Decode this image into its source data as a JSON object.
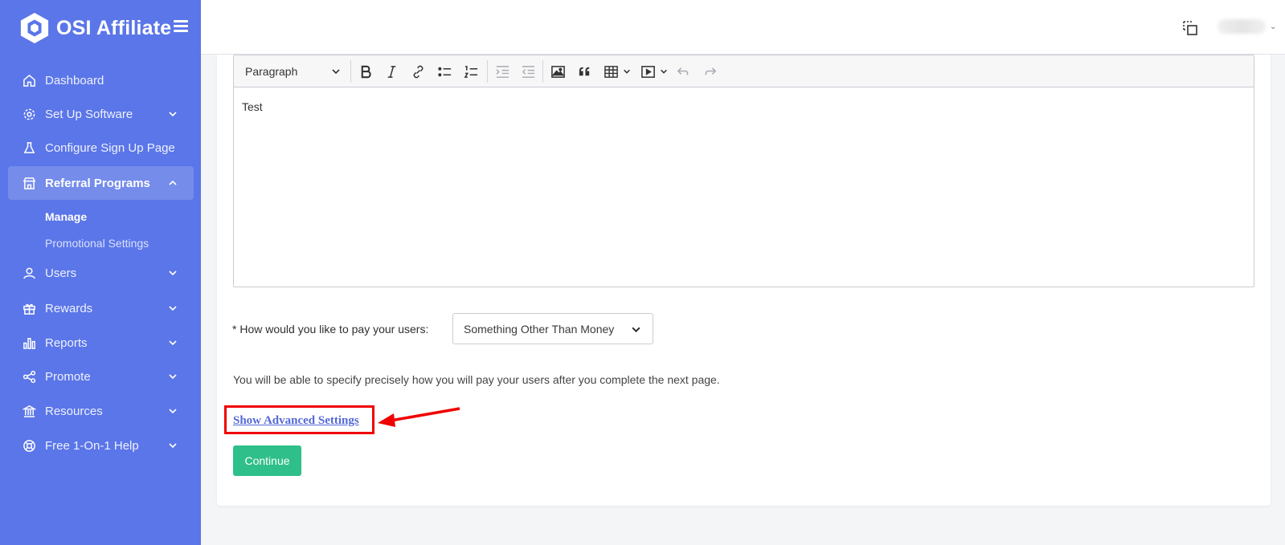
{
  "sidebar": {
    "brand_name": "OSI Affiliate",
    "items": [
      {
        "label": "Dashboard",
        "icon": "home-icon"
      },
      {
        "label": "Set Up Software",
        "icon": "gear-icon"
      },
      {
        "label": "Configure Sign Up Page",
        "icon": "flask-icon"
      },
      {
        "label": "Referral Programs",
        "icon": "store-icon"
      },
      {
        "label": "Users",
        "icon": "user-icon"
      },
      {
        "label": "Rewards",
        "icon": "gift-icon"
      },
      {
        "label": "Reports",
        "icon": "bar-chart-icon"
      },
      {
        "label": "Promote",
        "icon": "share-icon"
      },
      {
        "label": "Resources",
        "icon": "bank-icon"
      },
      {
        "label": "Free 1-On-1 Help",
        "icon": "lifebuoy-icon"
      }
    ],
    "sub_items": [
      {
        "label": "Manage"
      },
      {
        "label": "Promotional Settings"
      }
    ]
  },
  "editor": {
    "paragraph_style": "Paragraph",
    "content": "Test"
  },
  "payment": {
    "label": "* How would you like to pay your users:",
    "selected": "Something Other Than Money"
  },
  "info_text": "You will be able to specify precisely how you will pay your users after you complete the next page.",
  "advanced_link": "Show Advanced Settings",
  "continue_button": "Continue",
  "colors": {
    "sidebar": "#5b76e8",
    "continue": "#2fbf8a",
    "link": "#5568d6",
    "highlight": "#f00000"
  }
}
